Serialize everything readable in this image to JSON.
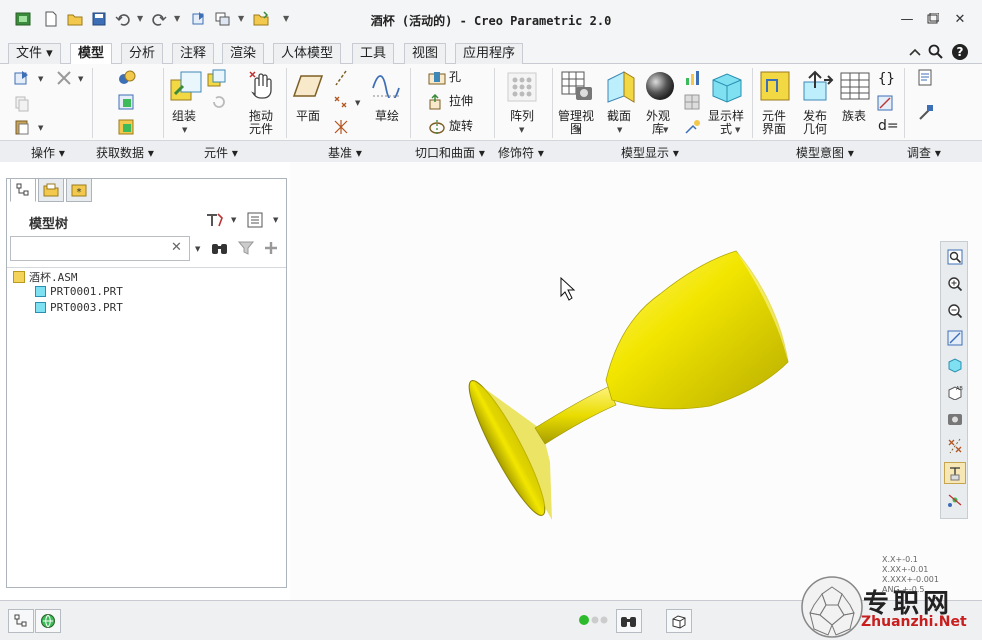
{
  "window": {
    "title": "酒杯 (活动的) - Creo Parametric 2.0",
    "controls": [
      "minimize-icon",
      "restore-icon",
      "close-icon"
    ]
  },
  "quick_access": [
    "window-icon",
    "new-icon",
    "open-icon",
    "save-icon",
    "undo-icon",
    "redo-icon",
    "regenerate-icon",
    "windows-icon",
    "folder-icon",
    "customize-icon"
  ],
  "tabs": [
    "文件",
    "模型",
    "分析",
    "注释",
    "渲染",
    "人体模型",
    "工具",
    "视图",
    "应用程序"
  ],
  "active_tab": "模型",
  "ribbon": {
    "groups": [
      "操作",
      "获取数据",
      "元件",
      "基准",
      "切口和曲面",
      "修饰符",
      "模型显示",
      "模型意图",
      "调查"
    ],
    "buttons": {
      "assemble": "组装",
      "drag_components": "拖动\n元件",
      "plane": "平面",
      "sketch": "草绘",
      "hole": "孔",
      "extrude": "拉伸",
      "revolve": "旋转",
      "pattern": "阵列",
      "manage_views": "管理视\n图",
      "section": "截面",
      "appearance": "外观\n库",
      "display_style": "显示样\n式",
      "component_interface": "元件\n界面",
      "publish_geometry": "发布\n几何",
      "family_table": "族表",
      "relations": "d="
    }
  },
  "model_tree": {
    "title": "模型树",
    "search_value": "",
    "items": [
      {
        "label": "酒杯.ASM",
        "type": "asm"
      },
      {
        "label": "PRT0001.PRT",
        "type": "prt"
      },
      {
        "label": "PRT0003.PRT",
        "type": "prt"
      }
    ]
  },
  "tolerance": [
    "X.X+-0.1",
    "X.XX+-0.01",
    "X.XXX+-0.001",
    "ANG.+-0.5"
  ],
  "watermark": {
    "text": "专职网",
    "url": "Zhuanzhi.Net"
  },
  "colors": {
    "model_yellow": "#f2e600",
    "model_shadow": "#a79d00",
    "selected_tool": "#f6e7b4",
    "status_green": "#2dbb2d",
    "brand_red": "#c81e1e"
  }
}
